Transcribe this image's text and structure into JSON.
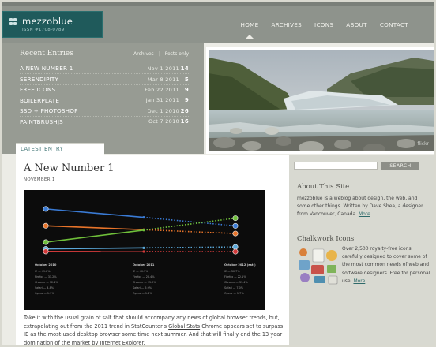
{
  "header": {
    "logo_name": "mezzoblue",
    "logo_issn": "ISSN #1708-0789",
    "nav": [
      "HOME",
      "ARCHIVES",
      "ICONS",
      "ABOUT",
      "CONTACT"
    ]
  },
  "recent": {
    "title": "Recent Entries",
    "tab_archives": "Archives",
    "tab_sep": "|",
    "tab_posts": "Posts only",
    "entries": [
      {
        "title": "A New Number 1",
        "date": "Nov 1 2011",
        "count": "14"
      },
      {
        "title": "Serendipity",
        "date": "Mar 8 2011",
        "count": "5"
      },
      {
        "title": "Free Icons",
        "date": "Feb 22 2011",
        "count": "9"
      },
      {
        "title": "Boilerplate",
        "date": "Jan 31 2011",
        "count": "9"
      },
      {
        "title": "SSD + Photoshop",
        "date": "Dec 1 2010",
        "count": "26"
      },
      {
        "title": "PaintbrushJS",
        "date": "Oct 7 2010",
        "count": "16"
      }
    ]
  },
  "hero": {
    "credit": "flickr"
  },
  "main": {
    "tab_label": "LATEST ENTRY",
    "post_title": "A New Number 1",
    "post_date": "NOVEMBER 1",
    "text_part1": "Take it with the usual grain of salt that should accompany any news of global browser trends, but, extrapolating out from the 2011 trend in StatCounter's ",
    "text_link": "Global Stats",
    "text_part2": " Chrome appears set to surpass IE as the most-used desktop browser some time next summer. And that will finally end the 13 year domination of the market by Internet Explorer."
  },
  "chart_data": {
    "type": "line",
    "x": [
      "October 2010",
      "October 2011",
      "October 2012 (est.)"
    ],
    "series": [
      {
        "name": "IE",
        "values": [
          49.8,
          40.3,
          30.7
        ],
        "color": "#3a7bd5"
      },
      {
        "name": "Firefox",
        "values": [
          30.8,
          26.4,
          22.1
        ],
        "color": "#e8742a"
      },
      {
        "name": "Chrome",
        "values": [
          12.4,
          25.9,
          39.4
        ],
        "color": "#6fbf3a"
      },
      {
        "name": "Safari",
        "values": [
          4.8,
          5.9,
          7.0
        ],
        "color": "#5aa7d8"
      },
      {
        "name": "Opera",
        "values": [
          1.9,
          1.8,
          1.7
        ],
        "color": "#d23a3a"
      }
    ],
    "column_labels": [
      {
        "heading": "October 2010",
        "lines": [
          "IE — 49.8%",
          "Firefox — 31.2%",
          "Chrome — 12.4%",
          "Safari — 4.8%",
          "Opera — 1.9%"
        ]
      },
      {
        "heading": "October 2011",
        "lines": [
          "IE — 40.3%",
          "Firefox — 26.4%",
          "Chrome — 25.9%",
          "Safari — 5.9%",
          "Opera — 1.8%"
        ]
      },
      {
        "heading": "October 2012 (est.)",
        "lines": [
          "IE — 30.7%",
          "Firefox — 22.1%",
          "Chrome — 39.4%",
          "Safari — 7.0%",
          "Opera — 1.7%"
        ]
      }
    ],
    "ylim": [
      0,
      55
    ]
  },
  "sidebar": {
    "search_placeholder": "",
    "search_button": "SEARCH",
    "about_title": "About This Site",
    "about_text": "mezzoblue is a weblog about design, the web, and some other things. Written by Dave Shea, a designer from Vancouver, Canada. ",
    "about_more": "More",
    "chalk_title": "Chalkwork Icons",
    "chalk_text": "Over 2,500 royalty-free icons, carefully designed to cover some of the most common needs of web and software designers. Free for personal use. ",
    "chalk_more": "More"
  }
}
